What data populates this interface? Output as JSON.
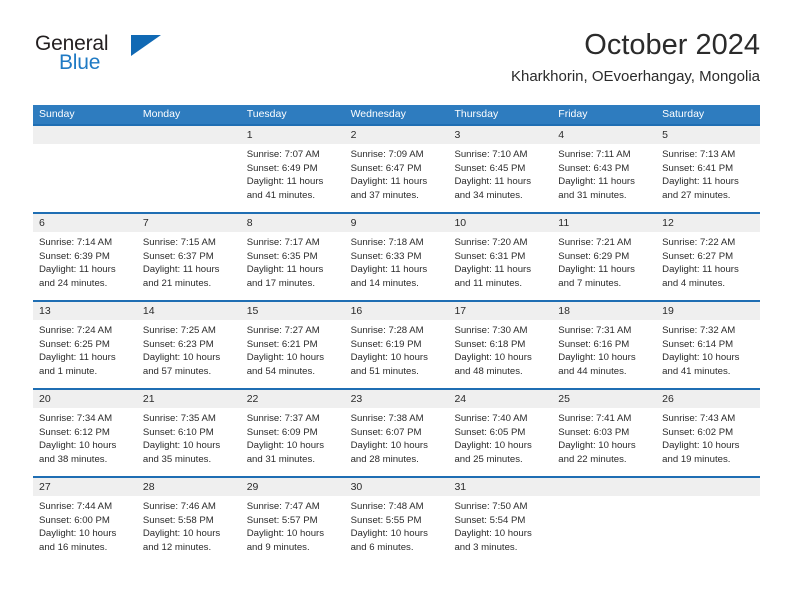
{
  "brand": {
    "name_part1": "General",
    "name_part2": "Blue",
    "triangle_color": "#1069b4",
    "blue_color": "#1f7ac4"
  },
  "header": {
    "title": "October 2024",
    "subtitle": "Kharkhorin, OEvoerhangay, Mongolia"
  },
  "theme": {
    "header_blue": "#2e7cbf",
    "row_border_blue": "#1f6eb3",
    "day_band_gray": "#efefef"
  },
  "weekdays": [
    "Sunday",
    "Monday",
    "Tuesday",
    "Wednesday",
    "Thursday",
    "Friday",
    "Saturday"
  ],
  "labels": {
    "sunrise": "Sunrise:",
    "sunset": "Sunset:",
    "daylight": "Daylight:"
  },
  "weeks": [
    [
      {
        "day": "",
        "sunrise": "",
        "sunset": "",
        "daylight": "",
        "empty": true
      },
      {
        "day": "",
        "sunrise": "",
        "sunset": "",
        "daylight": "",
        "empty": true
      },
      {
        "day": "1",
        "sunrise": "Sunrise: 7:07 AM",
        "sunset": "Sunset: 6:49 PM",
        "daylight": "Daylight: 11 hours and 41 minutes."
      },
      {
        "day": "2",
        "sunrise": "Sunrise: 7:09 AM",
        "sunset": "Sunset: 6:47 PM",
        "daylight": "Daylight: 11 hours and 37 minutes."
      },
      {
        "day": "3",
        "sunrise": "Sunrise: 7:10 AM",
        "sunset": "Sunset: 6:45 PM",
        "daylight": "Daylight: 11 hours and 34 minutes."
      },
      {
        "day": "4",
        "sunrise": "Sunrise: 7:11 AM",
        "sunset": "Sunset: 6:43 PM",
        "daylight": "Daylight: 11 hours and 31 minutes."
      },
      {
        "day": "5",
        "sunrise": "Sunrise: 7:13 AM",
        "sunset": "Sunset: 6:41 PM",
        "daylight": "Daylight: 11 hours and 27 minutes."
      }
    ],
    [
      {
        "day": "6",
        "sunrise": "Sunrise: 7:14 AM",
        "sunset": "Sunset: 6:39 PM",
        "daylight": "Daylight: 11 hours and 24 minutes."
      },
      {
        "day": "7",
        "sunrise": "Sunrise: 7:15 AM",
        "sunset": "Sunset: 6:37 PM",
        "daylight": "Daylight: 11 hours and 21 minutes."
      },
      {
        "day": "8",
        "sunrise": "Sunrise: 7:17 AM",
        "sunset": "Sunset: 6:35 PM",
        "daylight": "Daylight: 11 hours and 17 minutes."
      },
      {
        "day": "9",
        "sunrise": "Sunrise: 7:18 AM",
        "sunset": "Sunset: 6:33 PM",
        "daylight": "Daylight: 11 hours and 14 minutes."
      },
      {
        "day": "10",
        "sunrise": "Sunrise: 7:20 AM",
        "sunset": "Sunset: 6:31 PM",
        "daylight": "Daylight: 11 hours and 11 minutes."
      },
      {
        "day": "11",
        "sunrise": "Sunrise: 7:21 AM",
        "sunset": "Sunset: 6:29 PM",
        "daylight": "Daylight: 11 hours and 7 minutes."
      },
      {
        "day": "12",
        "sunrise": "Sunrise: 7:22 AM",
        "sunset": "Sunset: 6:27 PM",
        "daylight": "Daylight: 11 hours and 4 minutes."
      }
    ],
    [
      {
        "day": "13",
        "sunrise": "Sunrise: 7:24 AM",
        "sunset": "Sunset: 6:25 PM",
        "daylight": "Daylight: 11 hours and 1 minute."
      },
      {
        "day": "14",
        "sunrise": "Sunrise: 7:25 AM",
        "sunset": "Sunset: 6:23 PM",
        "daylight": "Daylight: 10 hours and 57 minutes."
      },
      {
        "day": "15",
        "sunrise": "Sunrise: 7:27 AM",
        "sunset": "Sunset: 6:21 PM",
        "daylight": "Daylight: 10 hours and 54 minutes."
      },
      {
        "day": "16",
        "sunrise": "Sunrise: 7:28 AM",
        "sunset": "Sunset: 6:19 PM",
        "daylight": "Daylight: 10 hours and 51 minutes."
      },
      {
        "day": "17",
        "sunrise": "Sunrise: 7:30 AM",
        "sunset": "Sunset: 6:18 PM",
        "daylight": "Daylight: 10 hours and 48 minutes."
      },
      {
        "day": "18",
        "sunrise": "Sunrise: 7:31 AM",
        "sunset": "Sunset: 6:16 PM",
        "daylight": "Daylight: 10 hours and 44 minutes."
      },
      {
        "day": "19",
        "sunrise": "Sunrise: 7:32 AM",
        "sunset": "Sunset: 6:14 PM",
        "daylight": "Daylight: 10 hours and 41 minutes."
      }
    ],
    [
      {
        "day": "20",
        "sunrise": "Sunrise: 7:34 AM",
        "sunset": "Sunset: 6:12 PM",
        "daylight": "Daylight: 10 hours and 38 minutes."
      },
      {
        "day": "21",
        "sunrise": "Sunrise: 7:35 AM",
        "sunset": "Sunset: 6:10 PM",
        "daylight": "Daylight: 10 hours and 35 minutes."
      },
      {
        "day": "22",
        "sunrise": "Sunrise: 7:37 AM",
        "sunset": "Sunset: 6:09 PM",
        "daylight": "Daylight: 10 hours and 31 minutes."
      },
      {
        "day": "23",
        "sunrise": "Sunrise: 7:38 AM",
        "sunset": "Sunset: 6:07 PM",
        "daylight": "Daylight: 10 hours and 28 minutes."
      },
      {
        "day": "24",
        "sunrise": "Sunrise: 7:40 AM",
        "sunset": "Sunset: 6:05 PM",
        "daylight": "Daylight: 10 hours and 25 minutes."
      },
      {
        "day": "25",
        "sunrise": "Sunrise: 7:41 AM",
        "sunset": "Sunset: 6:03 PM",
        "daylight": "Daylight: 10 hours and 22 minutes."
      },
      {
        "day": "26",
        "sunrise": "Sunrise: 7:43 AM",
        "sunset": "Sunset: 6:02 PM",
        "daylight": "Daylight: 10 hours and 19 minutes."
      }
    ],
    [
      {
        "day": "27",
        "sunrise": "Sunrise: 7:44 AM",
        "sunset": "Sunset: 6:00 PM",
        "daylight": "Daylight: 10 hours and 16 minutes."
      },
      {
        "day": "28",
        "sunrise": "Sunrise: 7:46 AM",
        "sunset": "Sunset: 5:58 PM",
        "daylight": "Daylight: 10 hours and 12 minutes."
      },
      {
        "day": "29",
        "sunrise": "Sunrise: 7:47 AM",
        "sunset": "Sunset: 5:57 PM",
        "daylight": "Daylight: 10 hours and 9 minutes."
      },
      {
        "day": "30",
        "sunrise": "Sunrise: 7:48 AM",
        "sunset": "Sunset: 5:55 PM",
        "daylight": "Daylight: 10 hours and 6 minutes."
      },
      {
        "day": "31",
        "sunrise": "Sunrise: 7:50 AM",
        "sunset": "Sunset: 5:54 PM",
        "daylight": "Daylight: 10 hours and 3 minutes."
      },
      {
        "day": "",
        "sunrise": "",
        "sunset": "",
        "daylight": "",
        "empty": true
      },
      {
        "day": "",
        "sunrise": "",
        "sunset": "",
        "daylight": "",
        "empty": true
      }
    ]
  ]
}
